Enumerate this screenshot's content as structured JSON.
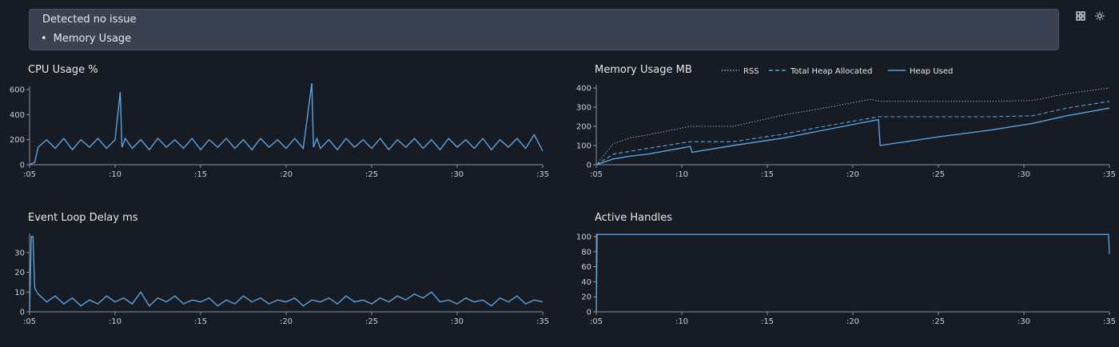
{
  "banner": {
    "title": "Detected no issue",
    "items": [
      "Memory Usage"
    ]
  },
  "toolbar": {
    "icons": [
      "grid-icon",
      "sun-icon"
    ]
  },
  "colors": {
    "series": "#5aa3e0",
    "axis": "#8c939f",
    "background": "#171b24",
    "banner": "#3a4252"
  },
  "chart_data": [
    {
      "id": "cpu",
      "type": "line",
      "title": "CPU Usage %",
      "x_ticks": [
        ":05",
        ":10",
        ":15",
        ":20",
        ":25",
        ":30",
        ":35"
      ],
      "xlim": [
        5,
        35
      ],
      "ylim": [
        0,
        600
      ],
      "y_ticks": [
        0,
        200,
        400,
        600
      ],
      "series": [
        {
          "values_x": [
            5,
            5.3,
            5.5,
            6,
            6.5,
            7,
            7.5,
            8,
            8.5,
            9,
            9.5,
            10,
            10.3,
            10.4,
            10.6,
            11,
            11.5,
            12,
            12.5,
            13,
            13.5,
            14,
            14.5,
            15,
            15.5,
            16,
            16.5,
            17,
            17.5,
            18,
            18.5,
            19,
            19.5,
            20,
            20.5,
            21,
            21.5,
            21.6,
            21.8,
            22,
            22.5,
            23,
            23.5,
            24,
            24.5,
            25,
            25.5,
            26,
            26.5,
            27,
            27.5,
            28,
            28.5,
            29,
            29.5,
            30,
            30.5,
            31,
            31.5,
            32,
            32.5,
            33,
            33.5,
            34,
            34.5,
            35
          ],
          "values_y": [
            0,
            20,
            140,
            200,
            130,
            210,
            120,
            200,
            140,
            210,
            130,
            200,
            580,
            140,
            210,
            130,
            200,
            120,
            210,
            140,
            200,
            130,
            210,
            120,
            200,
            140,
            210,
            130,
            200,
            120,
            210,
            140,
            200,
            130,
            210,
            130,
            650,
            140,
            210,
            130,
            200,
            120,
            210,
            140,
            200,
            130,
            210,
            120,
            200,
            140,
            210,
            130,
            200,
            120,
            210,
            140,
            200,
            130,
            210,
            120,
            200,
            140,
            210,
            130,
            240,
            110
          ]
        }
      ]
    },
    {
      "id": "memory",
      "type": "line",
      "title": "Memory Usage MB",
      "x_ticks": [
        ":05",
        ":10",
        ":15",
        ":20",
        ":25",
        ":30",
        ":35"
      ],
      "xlim": [
        5,
        35
      ],
      "ylim": [
        0,
        400
      ],
      "y_ticks": [
        0,
        100,
        200,
        300,
        400
      ],
      "series": [
        {
          "name": "RSS",
          "dash": "dotted",
          "values_x": [
            5,
            6,
            7,
            8,
            10.5,
            13,
            16,
            18,
            21,
            21.6,
            25,
            28,
            30.5,
            32.5,
            35
          ],
          "values_y": [
            0,
            110,
            140,
            155,
            200,
            200,
            260,
            290,
            340,
            330,
            330,
            330,
            335,
            370,
            400
          ]
        },
        {
          "name": "Total Heap Allocated",
          "dash": "dashed",
          "values_x": [
            5,
            6,
            7,
            8,
            10.5,
            13,
            16,
            18,
            21.5,
            21.6,
            25,
            28,
            30.5,
            32.5,
            35
          ],
          "values_y": [
            0,
            55,
            70,
            85,
            120,
            120,
            160,
            195,
            250,
            250,
            250,
            250,
            255,
            295,
            330
          ]
        },
        {
          "name": "Heap Used",
          "dash": "solid",
          "values_x": [
            5,
            6,
            7,
            8,
            10.5,
            10.6,
            13,
            16,
            18,
            21.5,
            21.6,
            25,
            28,
            30.5,
            32.5,
            35
          ],
          "values_y": [
            0,
            30,
            45,
            55,
            95,
            65,
            100,
            140,
            175,
            235,
            100,
            145,
            180,
            215,
            255,
            295
          ]
        }
      ]
    },
    {
      "id": "eventloop",
      "type": "line",
      "title": "Event Loop Delay ms",
      "x_ticks": [
        ":05",
        ":10",
        ":15",
        ":20",
        ":25",
        ":30",
        ":35"
      ],
      "xlim": [
        5,
        35
      ],
      "ylim": [
        0,
        38
      ],
      "y_ticks": [
        0,
        10,
        20,
        30
      ],
      "series": [
        {
          "values_x": [
            5,
            5.1,
            5.2,
            5.3,
            5.5,
            6,
            6.5,
            7,
            7.5,
            8,
            8.5,
            9,
            9.5,
            10,
            10.5,
            11,
            11.5,
            12,
            12.5,
            13,
            13.5,
            14,
            14.5,
            15,
            15.5,
            16,
            16.5,
            17,
            17.5,
            18,
            18.5,
            19,
            19.5,
            20,
            20.5,
            21,
            21.5,
            22,
            22.5,
            23,
            23.5,
            24,
            24.5,
            25,
            25.5,
            26,
            26.5,
            27,
            27.5,
            28,
            28.5,
            29,
            29.5,
            30,
            30.5,
            31,
            31.5,
            32,
            32.5,
            33,
            33.5,
            34,
            34.5,
            35
          ],
          "values_y": [
            0,
            38,
            38,
            12,
            9,
            5,
            8,
            4,
            7,
            3,
            6,
            4,
            8,
            5,
            7,
            4,
            10,
            3,
            7,
            5,
            8,
            4,
            6,
            5,
            7,
            3,
            6,
            4,
            8,
            5,
            7,
            4,
            6,
            5,
            7,
            3,
            6,
            5,
            7,
            4,
            8,
            5,
            6,
            4,
            7,
            5,
            8,
            6,
            9,
            7,
            10,
            5,
            6,
            4,
            7,
            5,
            6,
            3,
            7,
            5,
            8,
            4,
            6,
            5
          ]
        }
      ]
    },
    {
      "id": "handles",
      "type": "line",
      "title": "Active Handles",
      "x_ticks": [
        ":05",
        ":10",
        ":15",
        ":20",
        ":25",
        ":30",
        ":35"
      ],
      "xlim": [
        5,
        35
      ],
      "ylim": [
        0,
        100
      ],
      "y_ticks": [
        0,
        20,
        40,
        60,
        80,
        100
      ],
      "series": [
        {
          "values_x": [
            5,
            5.05,
            34.95,
            35
          ],
          "values_y": [
            0,
            103,
            103,
            77
          ]
        }
      ]
    }
  ]
}
